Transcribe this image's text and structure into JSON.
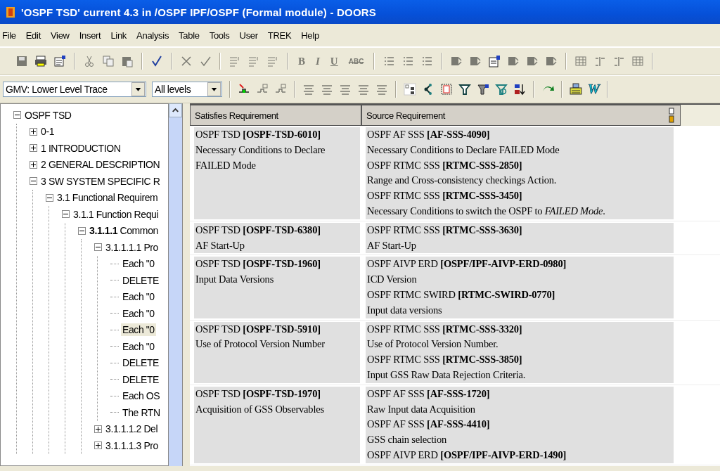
{
  "window": {
    "title": "'OSPF TSD' current 4.3 in /OSPF IPF/OSPF (Formal module) - DOORS"
  },
  "menu": [
    "File",
    "Edit",
    "View",
    "Insert",
    "Link",
    "Analysis",
    "Table",
    "Tools",
    "User",
    "TREK",
    "Help"
  ],
  "toolbar": {
    "format_buttons": [
      "B",
      "I",
      "U",
      "ABC"
    ],
    "view_dropdown": {
      "value": "GMV: Lower Level Trace"
    },
    "level_dropdown": {
      "value": "All levels"
    },
    "word_button": "W"
  },
  "tree": [
    {
      "label": "OSPF TSD",
      "expanded": true,
      "selected": false,
      "children": [
        {
          "label": "0-1",
          "expanded": false,
          "selected": false
        },
        {
          "label": "1 INTRODUCTION",
          "expanded": false,
          "selected": false
        },
        {
          "label": "2 GENERAL DESCRIPTION",
          "expanded": false,
          "selected": false
        },
        {
          "label": "3 SW SYSTEM SPECIFIC R",
          "expanded": true,
          "selected": false,
          "children": [
            {
              "label": "3.1 Functional Requirem",
              "expanded": true,
              "selected": false,
              "children": [
                {
                  "label": "3.1.1 Function Requi",
                  "expanded": true,
                  "selected": false,
                  "children": [
                    {
                      "label": "**3.1.1.1** Common",
                      "expanded": true,
                      "selected": false,
                      "children": [
                        {
                          "label": "3.1.1.1.1 Pro",
                          "expanded": true,
                          "selected": false,
                          "children": [
                            {
                              "label": "Each \"0",
                              "selected": false
                            },
                            {
                              "label": "DELETE",
                              "selected": false
                            },
                            {
                              "label": "Each \"0",
                              "selected": false
                            },
                            {
                              "label": "Each \"0",
                              "selected": false
                            },
                            {
                              "label": "Each \"0",
                              "selected": true
                            },
                            {
                              "label": "Each \"0",
                              "selected": false
                            },
                            {
                              "label": "DELETE",
                              "selected": false
                            },
                            {
                              "label": "DELETE",
                              "selected": false
                            },
                            {
                              "label": "Each OS",
                              "selected": false
                            },
                            {
                              "label": "The RTN",
                              "selected": false
                            }
                          ]
                        },
                        {
                          "label": "3.1.1.1.2 Del",
                          "expanded": false,
                          "selected": false
                        },
                        {
                          "label": "3.1.1.1.3 Pro",
                          "expanded": false,
                          "selected": false
                        }
                      ]
                    }
                  ]
                }
              ]
            }
          ]
        }
      ]
    }
  ],
  "table": {
    "columns": [
      "Satisfies Requirement",
      "Source Requirement"
    ],
    "rows": [
      {
        "satisfies": [
          "OSPF TSD  **[OSPF-TSD-6010]**",
          "Necessary Conditions to Declare FAILED Mode"
        ],
        "source": [
          "OSPF AF SSS  **[AF-SSS-4090]**",
          "Necessary Conditions to Declare FAILED Mode",
          "OSPF RTMC SSS  **[RTMC-SSS-2850]**",
          "Range and Cross-consistency checkings Action.",
          "OSPF RTMC SSS  **[RTMC-SSS-3450]**",
          "Necessary Conditions to switch the OSPF to *FAILED Mode*."
        ]
      },
      {
        "satisfies": [
          "OSPF TSD  **[OSPF-TSD-6380]**",
          "AF Start-Up"
        ],
        "source": [
          "OSPF RTMC SSS  **[RTMC-SSS-3630]**",
          "AF Start-Up"
        ]
      },
      {
        "satisfies": [
          "OSPF TSD  **[OSPF-TSD-1960]**",
          "Input Data Versions"
        ],
        "source": [
          "OSPF AIVP ERD  **[OSPF/IPF-AIVP-ERD-0980]**",
          "ICD Version",
          "OSPF RTMC SWIRD  **[RTMC-SWIRD-0770]**",
          "Input data versions"
        ]
      },
      {
        "satisfies": [
          "OSPF TSD  **[OSPF-TSD-5910]**",
          "Use of Protocol Version Number"
        ],
        "source": [
          "OSPF RTMC SSS  **[RTMC-SSS-3320]**",
          "Use of Protocol Version Number.",
          "OSPF RTMC SSS  **[RTMC-SSS-3850]**",
          "Input GSS Raw Data Rejection Criteria."
        ]
      },
      {
        "satisfies": [
          "OSPF TSD  **[OSPF-TSD-1970]**",
          "Acquisition of GSS Observables"
        ],
        "source": [
          "OSPF AF SSS  **[AF-SSS-1720]**",
          "Raw Input data Acquisition",
          "OSPF AF SSS  **[AF-SSS-4410]**",
          "GSS chain selection",
          "OSPF AIVP ERD  **[OSPF/IPF-AIVP-ERD-1490]**"
        ]
      }
    ]
  }
}
